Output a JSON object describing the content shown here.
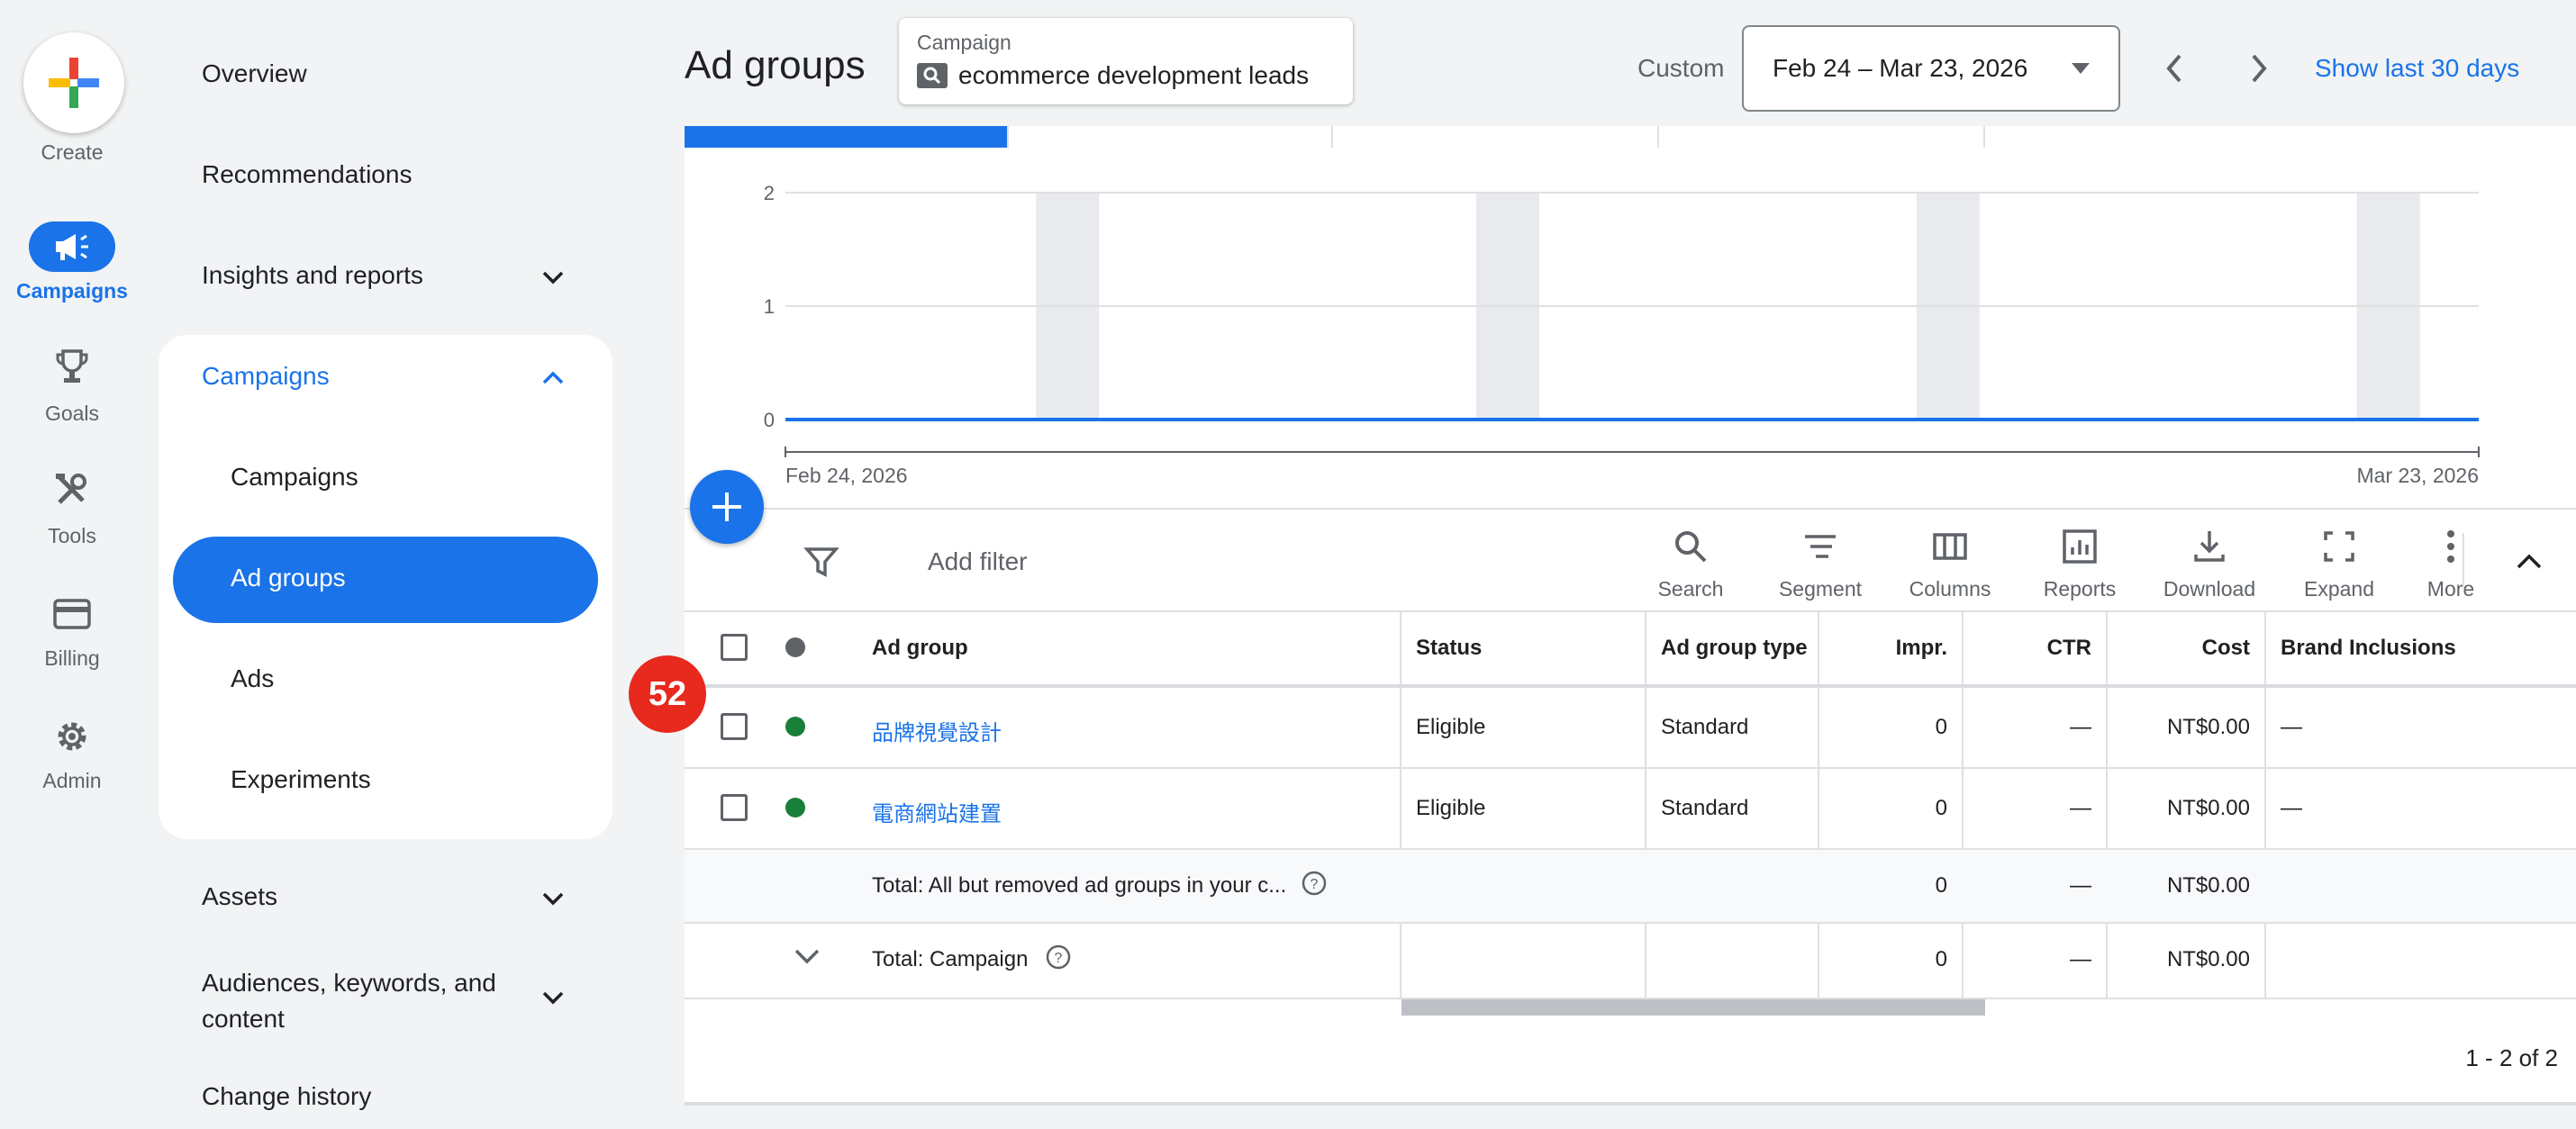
{
  "rail": {
    "create_label": "Create",
    "items": [
      {
        "label": "Campaigns",
        "icon": "megaphone-icon",
        "active": true
      },
      {
        "label": "Goals",
        "icon": "trophy-icon"
      },
      {
        "label": "Tools",
        "icon": "tools-icon"
      },
      {
        "label": "Billing",
        "icon": "credit-card-icon"
      },
      {
        "label": "Admin",
        "icon": "gear-icon"
      }
    ]
  },
  "sidenav": {
    "overview": "Overview",
    "recommendations": "Recommendations",
    "insights": "Insights and reports",
    "campaigns_header": "Campaigns",
    "sub": [
      "Campaigns",
      "Ad groups",
      "Ads",
      "Experiments"
    ],
    "assets": "Assets",
    "audiences_line1": "Audiences, keywords, and",
    "audiences_line2": "content",
    "change_history": "Change history"
  },
  "header": {
    "title": "Ad groups",
    "campaign_label": "Campaign",
    "campaign_name": "ecommerce development leads",
    "custom_label": "Custom",
    "date_range": "Feb 24 – Mar 23, 2026",
    "show_last": "Show last 30 days"
  },
  "chart_data": {
    "type": "line",
    "x_start_label": "Feb 24, 2026",
    "x_end_label": "Mar 23, 2026",
    "yticks": [
      "2",
      "1",
      "0"
    ],
    "ylim": [
      0,
      2
    ],
    "values": [
      0,
      0
    ],
    "series_color": "#1a73e8"
  },
  "toolbar": {
    "add_filter": "Add filter",
    "tools": [
      "Search",
      "Segment",
      "Columns",
      "Reports",
      "Download",
      "Expand",
      "More"
    ]
  },
  "table": {
    "headers": {
      "ad_group": "Ad group",
      "status": "Status",
      "type": "Ad group type",
      "impr": "Impr.",
      "ctr": "CTR",
      "cost": "Cost",
      "brand": "Brand Inclusions"
    },
    "rows": [
      {
        "name": "品牌視覺設計",
        "status": "Eligible",
        "type": "Standard",
        "impr": "0",
        "ctr": "—",
        "cost": "NT$0.00",
        "brand": "—"
      },
      {
        "name": "電商網站建置",
        "status": "Eligible",
        "type": "Standard",
        "impr": "0",
        "ctr": "—",
        "cost": "NT$0.00",
        "brand": "—"
      }
    ],
    "total_all": {
      "label": "Total: All but removed ad groups in your c...",
      "impr": "0",
      "ctr": "—",
      "cost": "NT$0.00"
    },
    "total_campaign": {
      "label": "Total: Campaign",
      "impr": "0",
      "ctr": "—",
      "cost": "NT$0.00"
    },
    "pagination": "1 - 2 of 2"
  },
  "badge": "52",
  "colors": {
    "accent": "#1a73e8",
    "eligible": "#188038",
    "badge": "#e8291e"
  }
}
